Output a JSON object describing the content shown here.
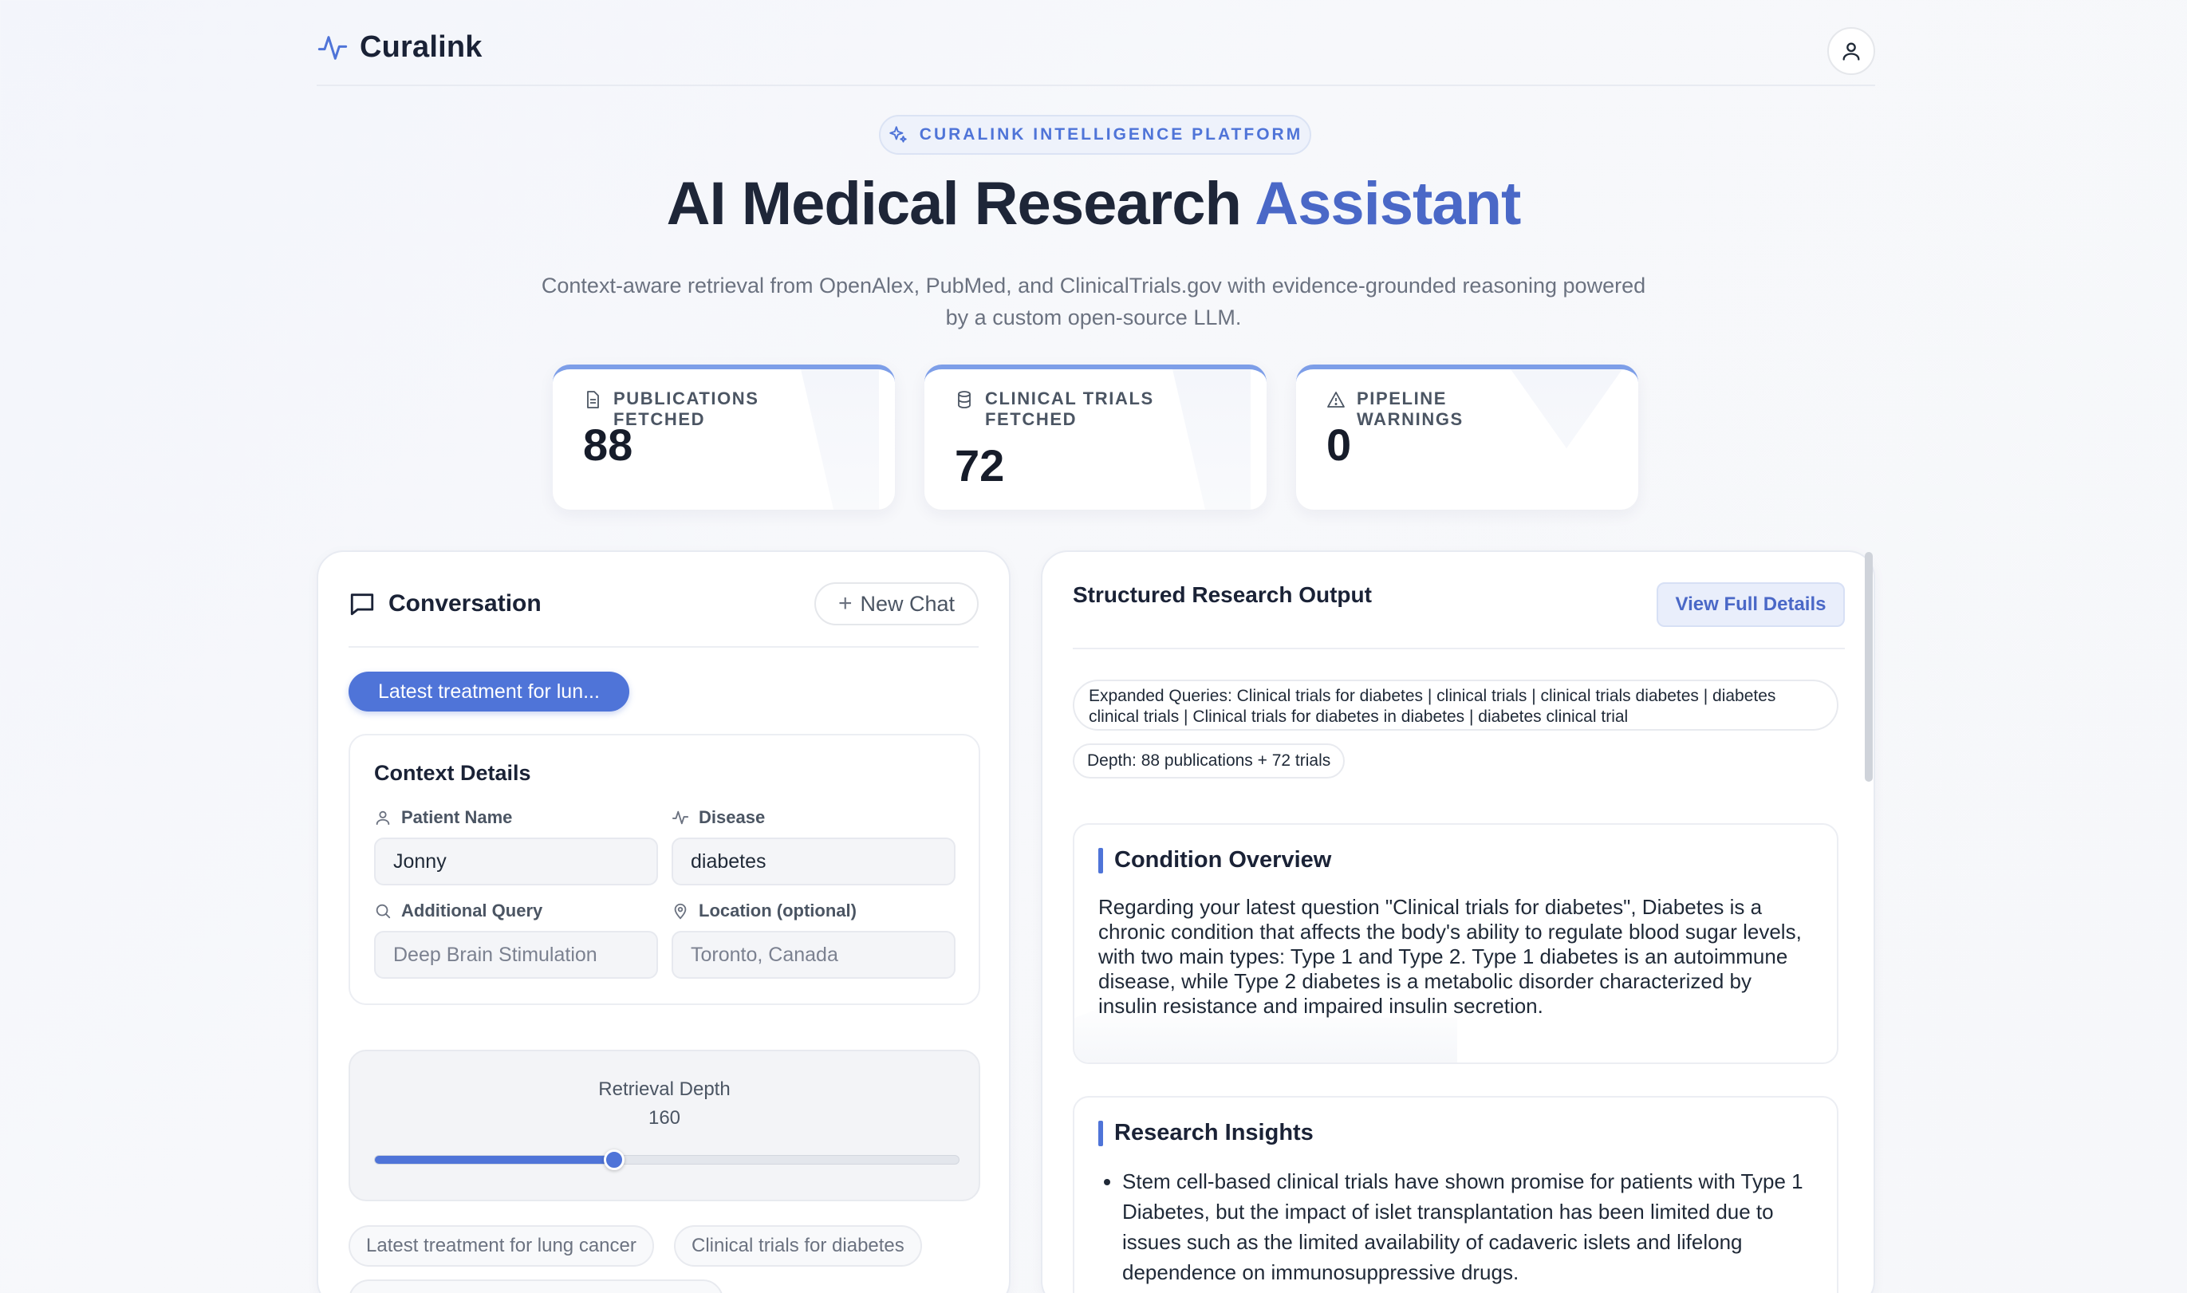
{
  "header": {
    "brand": "Curalink"
  },
  "hero": {
    "badge": "CURALINK INTELLIGENCE PLATFORM",
    "title_main": "AI Medical Research ",
    "title_accent": "Assistant",
    "subtitle": "Context-aware retrieval from OpenAlex, PubMed, and ClinicalTrials.gov with evidence-grounded reasoning powered by a custom open-source LLM."
  },
  "stats": [
    {
      "label": "PUBLICATIONS FETCHED",
      "value": "88",
      "icon": "document-icon"
    },
    {
      "label": "CLINICAL TRIALS FETCHED",
      "value": "72",
      "icon": "database-icon"
    },
    {
      "label": "PIPELINE WARNINGS",
      "value": "0",
      "icon": "warning-icon"
    }
  ],
  "conversation": {
    "title": "Conversation",
    "new_chat": "New Chat",
    "active_chip": "Latest treatment for lun...",
    "context": {
      "title": "Context Details",
      "patient_label": "Patient Name",
      "patient_value": "Jonny",
      "disease_label": "Disease",
      "disease_value": "diabetes",
      "query_label": "Additional Query",
      "query_placeholder": "Deep Brain Stimulation",
      "location_label": "Location (optional)",
      "location_placeholder": "Toronto, Canada"
    },
    "depth": {
      "label": "Retrieval Depth",
      "value": "160",
      "fraction": 0.41
    },
    "suggestions": [
      "Latest treatment for lung cancer",
      "Clinical trials for diabetes"
    ]
  },
  "output": {
    "title": "Structured Research Output",
    "view_button": "View Full Details",
    "expanded_queries": "Expanded Queries: Clinical trials for diabetes | clinical trials | clinical trials diabetes | diabetes clinical trials | Clinical trials for diabetes in diabetes | diabetes clinical trial",
    "depth_chip": "Depth: 88 publications + 72 trials",
    "condition": {
      "title": "Condition Overview",
      "text": "Regarding your latest question \"Clinical trials for diabetes\", Diabetes is a chronic condition that affects the body's ability to regulate blood sugar levels, with two main types: Type 1 and Type 2. Type 1 diabetes is an autoimmune disease, while Type 2 diabetes is a metabolic disorder characterized by insulin resistance and impaired insulin secretion."
    },
    "insights": {
      "title": "Research Insights",
      "items": [
        "Stem cell-based clinical trials have shown promise for patients with Type 1 Diabetes, but the impact of islet transplantation has been limited due to issues such as the limited availability of cadaveric islets and lifelong dependence on immunosuppressive drugs."
      ]
    }
  },
  "colors": {
    "accent": "#4f74d8",
    "accent_dark": "#4a68c7",
    "title": "#1e2638"
  }
}
